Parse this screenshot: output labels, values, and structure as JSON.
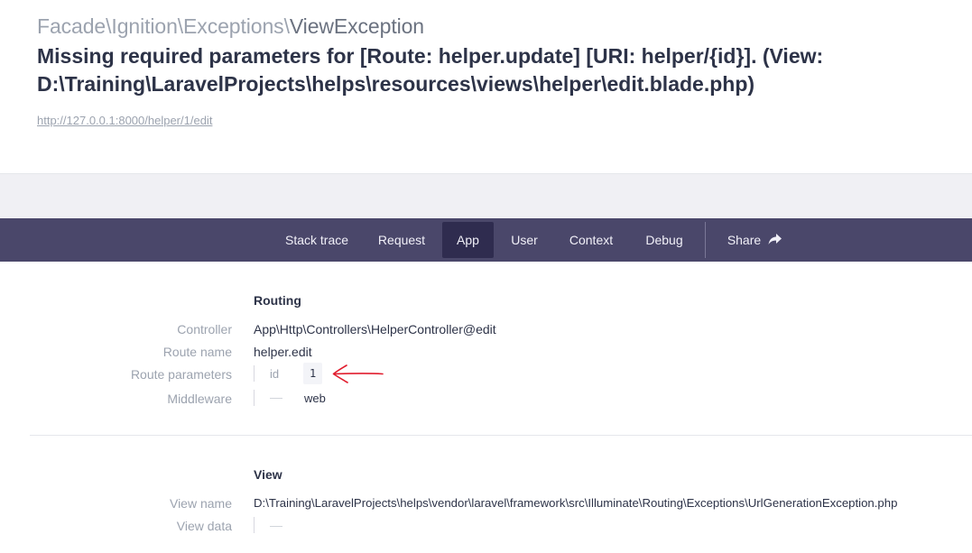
{
  "header": {
    "exception_prefix": "Facade\\Ignition\\Exceptions\\",
    "exception_name": "ViewException",
    "message": "Missing required parameters for [Route: helper.update] [URI: helper/{id}]. (View: D:\\Training\\LaravelProjects\\helps\\resources\\views\\helper\\edit.blade.php)",
    "url": "http://127.0.0.1:8000/helper/1/edit"
  },
  "tabs": {
    "stack_trace": "Stack trace",
    "request": "Request",
    "app": "App",
    "user": "User",
    "context": "Context",
    "debug": "Debug",
    "share": "Share",
    "active": "App"
  },
  "routing": {
    "title": "Routing",
    "controller_label": "Controller",
    "controller_value": "App\\Http\\Controllers\\HelperController@edit",
    "route_name_label": "Route name",
    "route_name_value": "helper.edit",
    "route_params_label": "Route parameters",
    "route_param_key": "id",
    "route_param_value": "1",
    "middleware_label": "Middleware",
    "middleware_value": "web"
  },
  "view": {
    "title": "View",
    "view_name_label": "View name",
    "view_name_value": "D:\\Training\\LaravelProjects\\helps\\vendor\\laravel\\framework\\src\\Illuminate\\Routing\\Exceptions\\UrlGenerationException.php",
    "view_data_label": "View data"
  },
  "colors": {
    "tabbar": "#4a476a",
    "tab_active": "#2f2c4f",
    "annotation_arrow": "#e11d2e"
  },
  "icons": {
    "share": "share-arrow-icon",
    "annotation": "red-arrow-annotation-icon"
  }
}
